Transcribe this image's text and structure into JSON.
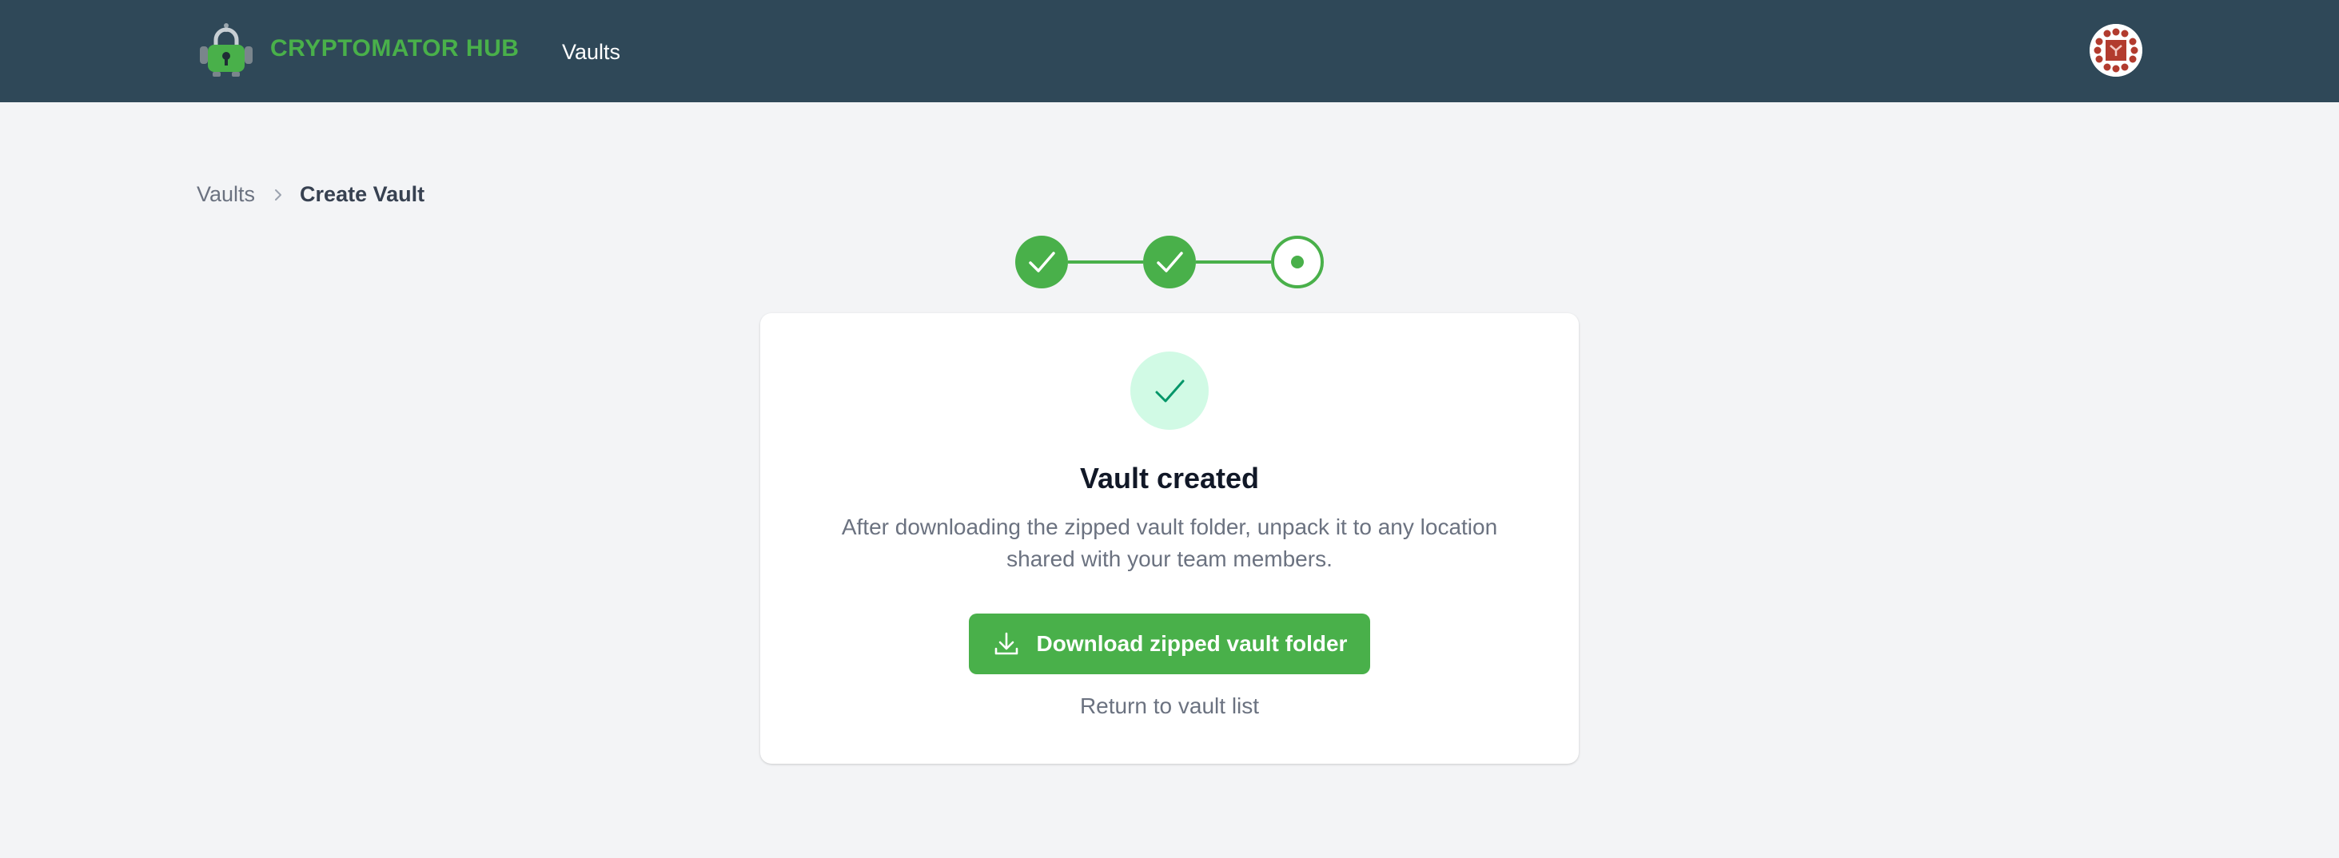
{
  "header": {
    "brand": "CRYPTOMATOR HUB",
    "nav_vaults": "Vaults"
  },
  "breadcrumb": {
    "parent": "Vaults",
    "current": "Create Vault"
  },
  "stepper": {
    "total_steps": 3,
    "completed_steps": 2,
    "current_step": 3
  },
  "card": {
    "title": "Vault created",
    "description": "After downloading the zipped vault folder, unpack it to any location shared with your team members.",
    "download_button": "Download zipped vault folder",
    "return_link": "Return to vault list"
  },
  "icons": {
    "logo": "robot-lock-logo-icon",
    "avatar": "user-avatar-icon",
    "breadcrumb_separator": "chevron-right-icon",
    "step_done": "check-icon",
    "step_current": "dot-icon",
    "success": "check-icon",
    "download": "download-icon"
  },
  "colors": {
    "header_bg": "#2f4858",
    "brand_green": "#49b04a",
    "page_bg": "#f3f4f6",
    "success_bg": "#d1fae5",
    "success_check": "#059669",
    "muted_text": "#6b7280"
  }
}
